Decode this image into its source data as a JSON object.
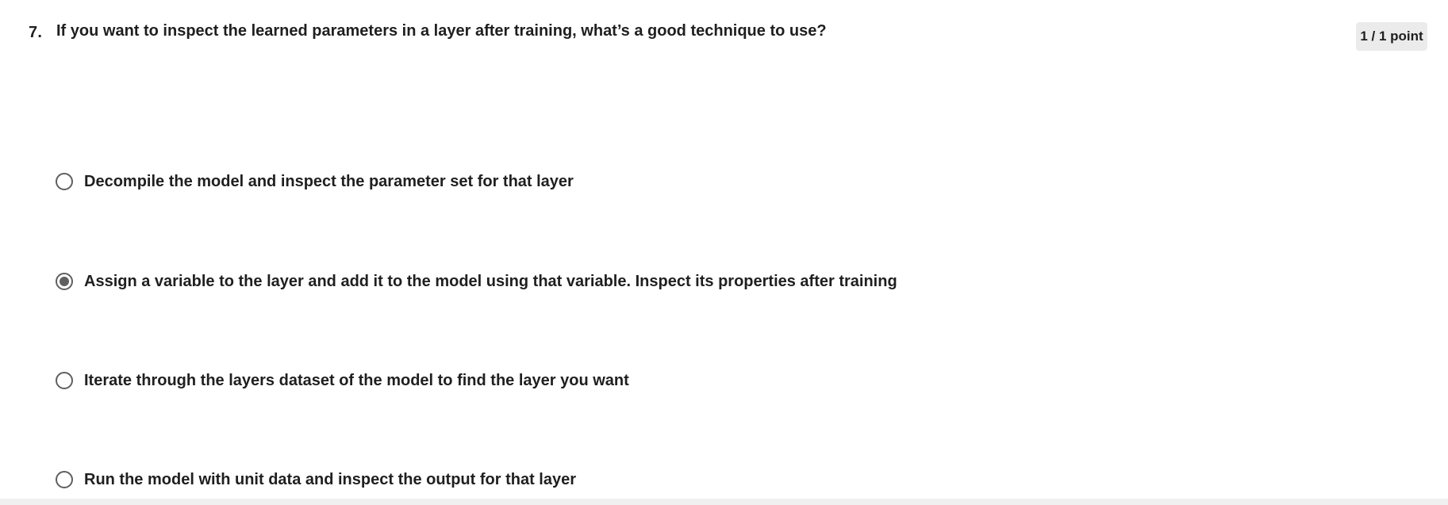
{
  "question": {
    "number": "7.",
    "text": "If you want to inspect the learned parameters in a layer after training, what’s a good technique to use?",
    "points": "1 / 1 point"
  },
  "options": [
    {
      "label": "Decompile the model and inspect the parameter set for that layer",
      "selected": false
    },
    {
      "label": "Assign a variable to the layer and add it to the model using that variable. Inspect its properties after training",
      "selected": true
    },
    {
      "label": "Iterate through the layers dataset of the model to find the layer you want",
      "selected": false
    },
    {
      "label": "Run the model with unit data and inspect the output for that layer",
      "selected": false
    }
  ],
  "colors": {
    "text": "#1f1f1f",
    "radio_border": "#5f5f5f",
    "badge_bg": "#ebebeb"
  }
}
